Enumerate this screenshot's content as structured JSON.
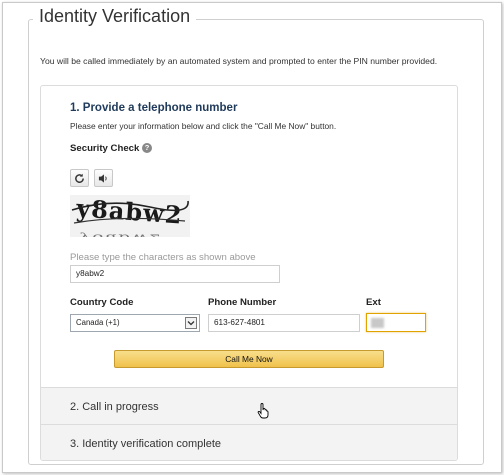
{
  "page": {
    "title": "Identity Verification",
    "intro": "You will be called immediately by an automated system and prompted to enter the PIN number provided."
  },
  "step1": {
    "title": "1. Provide a telephone number",
    "instructions": "Please enter your information below and click the \"Call Me Now\" button.",
    "security_check_label": "Security Check",
    "help_icon": "question-circle-icon",
    "refresh_icon": "refresh-icon",
    "audio_icon": "speaker-icon",
    "captcha_text": "y8abw2",
    "captcha_hint": "Please type the characters as shown above",
    "captcha_value": "y8abw2",
    "country_label": "Country Code",
    "country_value": "Canada (+1)",
    "phone_label": "Phone Number",
    "phone_value": "613-627-4801",
    "ext_label": "Ext",
    "call_button": "Call Me Now"
  },
  "step2": {
    "title": "2. Call in progress"
  },
  "step3": {
    "title": "3. Identity verification complete"
  },
  "colors": {
    "heading_blue": "#1f3a5a",
    "button_top": "#f8df8c",
    "button_bottom": "#f0c14b",
    "focus_border": "#e0a300",
    "step_bg": "#f3f3f3"
  }
}
